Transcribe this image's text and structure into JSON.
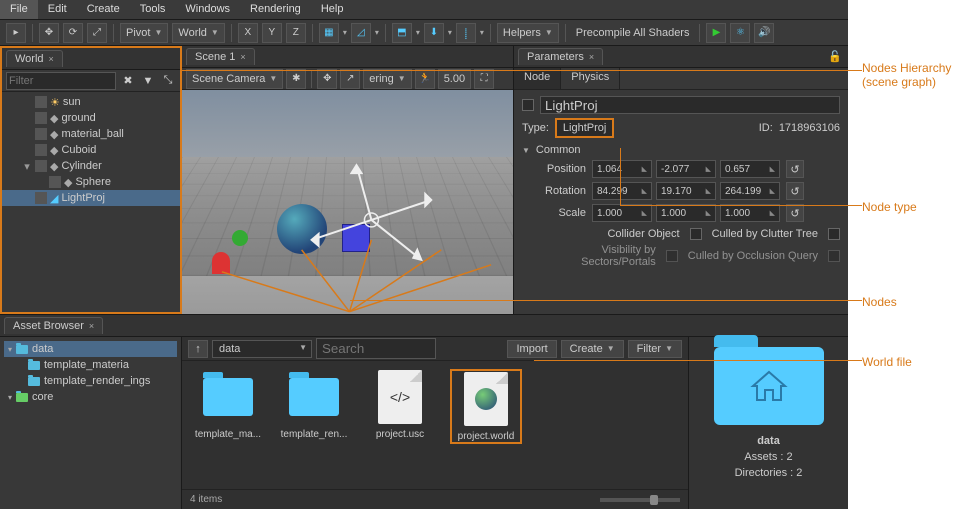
{
  "menu": [
    "File",
    "Edit",
    "Create",
    "Tools",
    "Windows",
    "Rendering",
    "Help"
  ],
  "toolbar": {
    "pivot": "Pivot",
    "space": "World",
    "axes": [
      "X",
      "Y",
      "Z"
    ],
    "helpers": "Helpers",
    "precompile": "Precompile All Shaders"
  },
  "worldPanel": {
    "tab": "World",
    "filter": "Filter",
    "items": [
      {
        "label": "sun",
        "icon": "sun",
        "indent": 1
      },
      {
        "label": "ground",
        "icon": "mesh",
        "indent": 1
      },
      {
        "label": "material_ball",
        "icon": "mesh",
        "indent": 1
      },
      {
        "label": "Cuboid",
        "icon": "mesh",
        "indent": 1
      },
      {
        "label": "Cylinder",
        "icon": "mesh",
        "indent": 1,
        "expanded": true
      },
      {
        "label": "Sphere",
        "icon": "mesh",
        "indent": 2
      },
      {
        "label": "LightProj",
        "icon": "light",
        "indent": 1,
        "selected": true
      }
    ]
  },
  "scenePanel": {
    "tab": "Scene 1",
    "camera": "Scene Camera",
    "speed": "ering",
    "value": "5.00"
  },
  "paramsPanel": {
    "tab": "Parameters",
    "subtabs": [
      "Node",
      "Physics"
    ],
    "name": "LightProj",
    "typeLabel": "Type:",
    "type": "LightProj",
    "idLabel": "ID:",
    "id": "1718963106",
    "common": "Common",
    "rows": {
      "posLabel": "Position",
      "pos": [
        "1.064",
        "-2.077",
        "0.657"
      ],
      "rotLabel": "Rotation",
      "rot": [
        "84.299",
        "19.170",
        "264.199"
      ],
      "sclLabel": "Scale",
      "scl": [
        "1.000",
        "1.000",
        "1.000"
      ]
    },
    "checks": {
      "collider": "Collider Object",
      "clutter": "Culled by Clutter Tree",
      "sectors": "Visibility by Sectors/Portals",
      "occlusion": "Culled by Occlusion Query"
    }
  },
  "assetBrowser": {
    "tab": "Asset Browser",
    "tree": [
      {
        "label": "data",
        "sel": true,
        "indent": 0,
        "icon": "folder"
      },
      {
        "label": "template_materia",
        "indent": 1,
        "icon": "folder"
      },
      {
        "label": "template_render_ings",
        "indent": 1,
        "icon": "folder"
      },
      {
        "label": "core",
        "indent": 0,
        "icon": "folder-green"
      }
    ],
    "up": "↑",
    "path": "data",
    "search": "Search",
    "import": "Import",
    "create": "Create",
    "filter": "Filter",
    "items": [
      {
        "label": "template_ma...",
        "type": "folder"
      },
      {
        "label": "template_ren...",
        "type": "folder"
      },
      {
        "label": "project.usc",
        "type": "code"
      },
      {
        "label": "project.world",
        "type": "world",
        "sel": true
      }
    ],
    "count": "4 items",
    "preview": {
      "name": "data",
      "assets": "Assets : 2",
      "dirs": "Directories : 2"
    }
  },
  "annotations": {
    "hierarchy": "Nodes Hierarchy\n(scene graph)",
    "nodetype": "Node type",
    "nodes": "Nodes",
    "worldfile": "World file"
  }
}
